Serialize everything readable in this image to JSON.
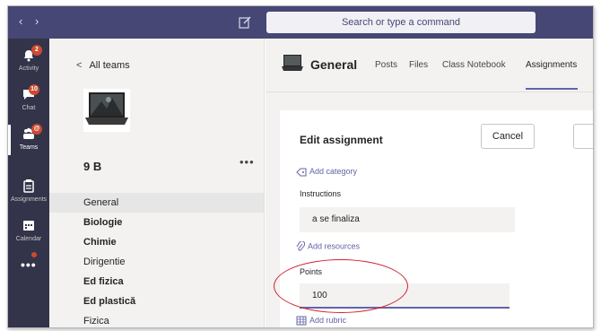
{
  "topbar": {
    "back_glyph": "‹",
    "forward_glyph": "›",
    "search_placeholder": "Search or type a command"
  },
  "rail": {
    "items": [
      {
        "label": "Activity",
        "badge": "2",
        "icon": "bell-icon"
      },
      {
        "label": "Chat",
        "badge": "10",
        "icon": "chat-icon"
      },
      {
        "label": "Teams",
        "badge": "@",
        "icon": "teams-icon"
      },
      {
        "label": "Assignments",
        "icon": "assignments-icon"
      },
      {
        "label": "Calendar",
        "icon": "calendar-icon"
      }
    ],
    "more": "•••"
  },
  "panel": {
    "back_label": "All teams",
    "team_name": "9 B",
    "team_more": "•••",
    "channels": [
      {
        "name": "General",
        "selected": true,
        "bold": false
      },
      {
        "name": "Biologie",
        "selected": false,
        "bold": true
      },
      {
        "name": "Chimie",
        "selected": false,
        "bold": true
      },
      {
        "name": "Dirigentie",
        "selected": false,
        "bold": false
      },
      {
        "name": "Ed fizica",
        "selected": false,
        "bold": true
      },
      {
        "name": "Ed plastică",
        "selected": false,
        "bold": true
      },
      {
        "name": "Fizica",
        "selected": false,
        "bold": false
      }
    ]
  },
  "header": {
    "channel_title": "General",
    "tabs": [
      "Posts",
      "Files",
      "Class Notebook",
      "Assignments"
    ],
    "active_tab": "Assignments"
  },
  "form": {
    "title": "Edit assignment",
    "cancel_label": "Cancel",
    "add_category": "Add category",
    "instructions_label": "Instructions",
    "instructions_value": "a se finaliza",
    "add_resources": "Add resources",
    "points_label": "Points",
    "points_value": "100",
    "add_rubric": "Add rubric"
  },
  "colors": {
    "topbar": "#464775",
    "rail": "#33344a",
    "accent": "#6264a7",
    "badge": "#cc4a31",
    "annotation": "#d0232f"
  }
}
